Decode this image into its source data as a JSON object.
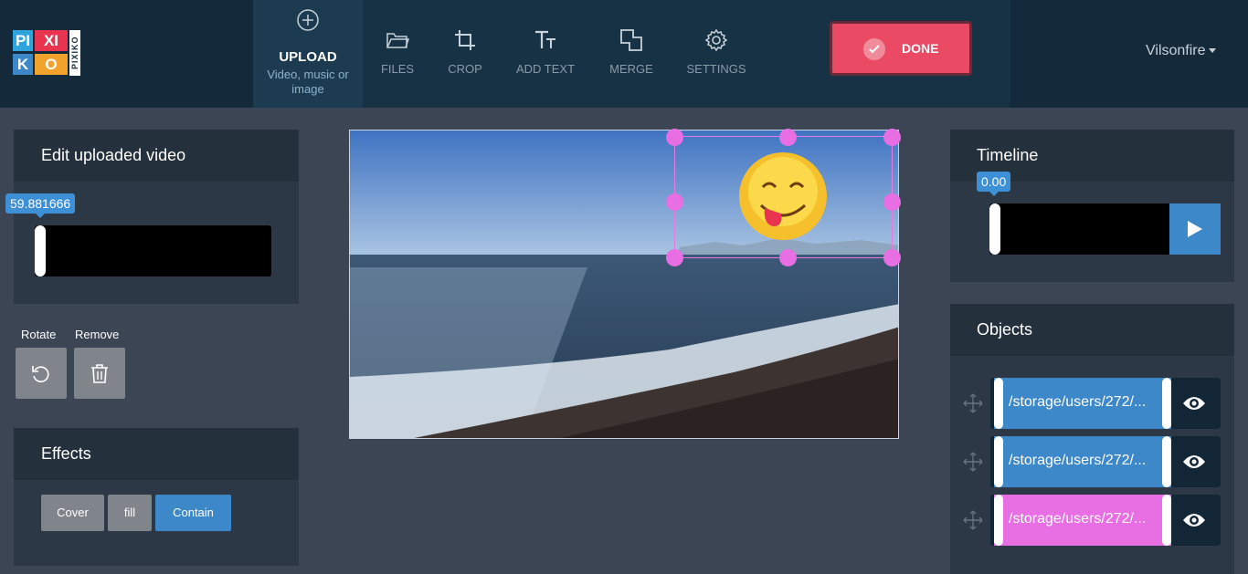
{
  "header": {
    "upload_label": "UPLOAD",
    "upload_sub": "Video, music or image",
    "tools": [
      {
        "label": "FILES",
        "icon": "folder-icon"
      },
      {
        "label": "CROP",
        "icon": "crop-icon"
      },
      {
        "label": "ADD TEXT",
        "icon": "text-icon"
      },
      {
        "label": "MERGE",
        "icon": "merge-icon"
      },
      {
        "label": "SETTINGS",
        "icon": "gear-icon"
      }
    ],
    "done_label": "DONE",
    "username": "Vilsonfire"
  },
  "logo": {
    "letters": [
      "PI",
      "XI",
      "K",
      "O"
    ],
    "vertical": "PIXIKO"
  },
  "edit_panel": {
    "title": "Edit uploaded video",
    "tooltip_value": "59.881666",
    "rotate_label": "Rotate",
    "remove_label": "Remove"
  },
  "effects": {
    "title": "Effects",
    "buttons": [
      "Cover",
      "fill",
      "Contain"
    ],
    "active": "Contain"
  },
  "timeline": {
    "title": "Timeline",
    "value": "0.00"
  },
  "objects": {
    "title": "Objects",
    "items": [
      {
        "label": "/storage/users/272/...",
        "color": "#3d88c9"
      },
      {
        "label": "/storage/users/272/...",
        "color": "#3d88c9"
      },
      {
        "label": "/storage/users/272/...",
        "color": "#e86ee3"
      }
    ]
  },
  "colors": {
    "accent_blue": "#3d88c9",
    "done_red": "#ea4a63",
    "selection_pink": "#e86ee3"
  }
}
